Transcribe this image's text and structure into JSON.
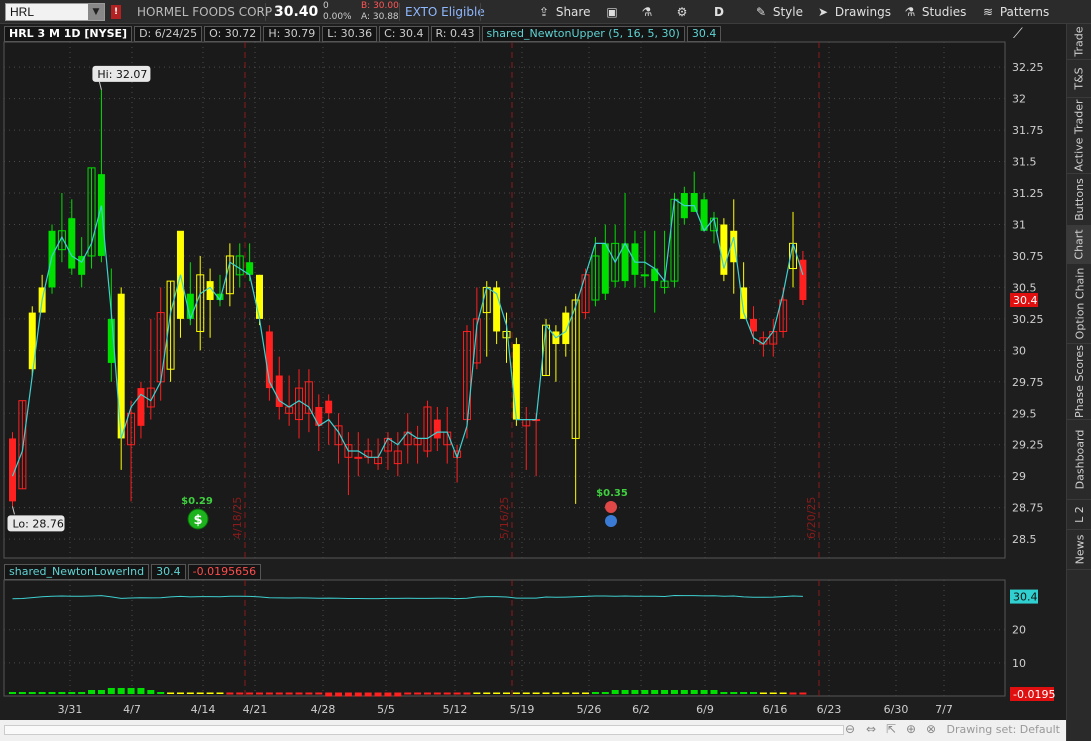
{
  "toolbar": {
    "symbol": "HRL",
    "company": "HORMEL FOODS CORP",
    "last": "30.40",
    "chg_abs": "0",
    "chg_pct": "0.00%",
    "bid": "B: 30.00",
    "ask": "A: 30.88",
    "exto": "EXTO Eligible",
    "share": "Share",
    "aggregation": "D",
    "style": "Style",
    "drawings": "Drawings",
    "studies": "Studies",
    "patterns": "Patterns"
  },
  "header": {
    "symbol": "HRL 3 M 1D [NYSE]",
    "date": "D: 6/24/25",
    "open": "O: 30.72",
    "high": "H: 30.79",
    "low": "L: 30.36",
    "close": "C: 30.4",
    "range": "R: 0.43",
    "study": "shared_NewtonUpper (5, 16, 5, 30)",
    "study_val": "30.4"
  },
  "lower_header": {
    "study": "shared_NewtonLowerInd",
    "value": "30.4",
    "delta": "-0.0195656"
  },
  "annotations": {
    "hi": "Hi: 32.07",
    "lo": "Lo: 28.76",
    "div1": "$0.29",
    "div2": "$0.35",
    "price_tag": "30.4",
    "lower_tag_top": "30.4",
    "lower_tag_bottom": "-0.0195"
  },
  "side_tabs": [
    "Trade",
    "T&S",
    "Active Trader",
    "Buttons",
    "Chart",
    "Option Chain",
    "Phase Scores",
    "Dashboard",
    "L 2",
    "News"
  ],
  "bottom": {
    "drawing_set": "Drawing set: Default"
  },
  "colors": {
    "up": "#00e000",
    "down": "#ff2020",
    "up_weak": "#ffff00",
    "line": "#3fd0d0",
    "grid": "#444444",
    "month_sep": "#8b1a1a"
  },
  "chart_data": {
    "type": "candlestick",
    "price_axis": [
      28.5,
      28.75,
      29,
      29.25,
      29.5,
      29.75,
      30,
      30.25,
      30.5,
      30.75,
      31,
      31.25,
      31.5,
      31.75,
      32,
      32.25
    ],
    "lower_axis": [
      10,
      20
    ],
    "x_ticks": [
      "3/31",
      "4/7",
      "4/14",
      "4/21",
      "4/28",
      "5/5",
      "5/12",
      "5/19",
      "5/26",
      "6/2",
      "6/9",
      "6/16",
      "6/23",
      "6/30",
      "7/7"
    ],
    "month_markers": [
      "4/18/25",
      "5/16/25",
      "6/20/25"
    ],
    "ylim": [
      28.35,
      32.45
    ],
    "candles": [
      {
        "o": 29.3,
        "h": 29.35,
        "l": 28.76,
        "c": 28.8,
        "k": "d"
      },
      {
        "o": 28.9,
        "h": 29.6,
        "l": 28.9,
        "c": 29.6,
        "k": "dh"
      },
      {
        "o": 29.85,
        "h": 30.35,
        "l": 29.8,
        "c": 30.3,
        "k": "y"
      },
      {
        "o": 30.3,
        "h": 30.6,
        "l": 30.3,
        "c": 30.5,
        "k": "y"
      },
      {
        "o": 30.5,
        "h": 31.0,
        "l": 30.45,
        "c": 30.95,
        "k": "g"
      },
      {
        "o": 30.95,
        "h": 31.25,
        "l": 30.7,
        "c": 30.8,
        "k": "gh"
      },
      {
        "o": 30.65,
        "h": 31.2,
        "l": 30.6,
        "c": 31.05,
        "k": "g"
      },
      {
        "o": 30.6,
        "h": 30.9,
        "l": 30.5,
        "c": 30.75,
        "k": "g"
      },
      {
        "o": 30.75,
        "h": 31.45,
        "l": 30.65,
        "c": 31.45,
        "k": "gh"
      },
      {
        "o": 30.75,
        "h": 32.07,
        "l": 30.7,
        "c": 31.4,
        "k": "g"
      },
      {
        "o": 30.25,
        "h": 30.65,
        "l": 29.75,
        "c": 29.9,
        "k": "g"
      },
      {
        "o": 30.45,
        "h": 30.5,
        "l": 29.05,
        "c": 29.3,
        "k": "y"
      },
      {
        "o": 29.25,
        "h": 29.6,
        "l": 28.8,
        "c": 29.5,
        "k": "dh"
      },
      {
        "o": 29.4,
        "h": 29.75,
        "l": 29.3,
        "c": 29.7,
        "k": "d"
      },
      {
        "o": 29.55,
        "h": 30.25,
        "l": 29.45,
        "c": 29.7,
        "k": "dh"
      },
      {
        "o": 29.75,
        "h": 30.5,
        "l": 29.6,
        "c": 30.3,
        "k": "dh"
      },
      {
        "o": 29.85,
        "h": 30.55,
        "l": 29.75,
        "c": 30.55,
        "k": "yh"
      },
      {
        "o": 30.25,
        "h": 30.85,
        "l": 30.1,
        "c": 30.95,
        "k": "y"
      },
      {
        "o": 30.45,
        "h": 30.7,
        "l": 30.2,
        "c": 30.25,
        "k": "g"
      },
      {
        "o": 30.15,
        "h": 30.75,
        "l": 30.0,
        "c": 30.6,
        "k": "yh"
      },
      {
        "o": 30.55,
        "h": 30.65,
        "l": 30.1,
        "c": 30.4,
        "k": "y"
      },
      {
        "o": 30.4,
        "h": 30.6,
        "l": 30.35,
        "c": 30.45,
        "k": "g"
      },
      {
        "o": 30.45,
        "h": 30.85,
        "l": 30.35,
        "c": 30.75,
        "k": "yh"
      },
      {
        "o": 30.6,
        "h": 30.85,
        "l": 30.5,
        "c": 30.75,
        "k": "gh"
      },
      {
        "o": 30.6,
        "h": 30.85,
        "l": 30.55,
        "c": 30.7,
        "k": "g"
      },
      {
        "o": 30.25,
        "h": 30.6,
        "l": 30.2,
        "c": 30.6,
        "k": "y"
      },
      {
        "o": 30.15,
        "h": 30.2,
        "l": 29.6,
        "c": 29.7,
        "k": "d"
      },
      {
        "o": 29.8,
        "h": 29.95,
        "l": 29.45,
        "c": 29.55,
        "k": "d"
      },
      {
        "o": 29.5,
        "h": 29.8,
        "l": 29.4,
        "c": 29.55,
        "k": "dh"
      },
      {
        "o": 29.45,
        "h": 29.85,
        "l": 29.3,
        "c": 29.7,
        "k": "dh"
      },
      {
        "o": 29.75,
        "h": 29.85,
        "l": 29.35,
        "c": 29.5,
        "k": "dh"
      },
      {
        "o": 29.55,
        "h": 29.65,
        "l": 29.2,
        "c": 29.4,
        "k": "d"
      },
      {
        "o": 29.6,
        "h": 29.65,
        "l": 29.25,
        "c": 29.5,
        "k": "d"
      },
      {
        "o": 29.4,
        "h": 29.5,
        "l": 29.1,
        "c": 29.25,
        "k": "dh"
      },
      {
        "o": 29.25,
        "h": 29.35,
        "l": 28.85,
        "c": 29.15,
        "k": "dh"
      },
      {
        "o": 29.15,
        "h": 29.35,
        "l": 29.0,
        "c": 29.15,
        "k": "dh"
      },
      {
        "o": 29.2,
        "h": 29.3,
        "l": 29.1,
        "c": 29.15,
        "k": "dh"
      },
      {
        "o": 29.1,
        "h": 29.3,
        "l": 29.05,
        "c": 29.15,
        "k": "dh"
      },
      {
        "o": 29.3,
        "h": 29.35,
        "l": 29.05,
        "c": 29.2,
        "k": "dh"
      },
      {
        "o": 29.1,
        "h": 29.35,
        "l": 29.0,
        "c": 29.2,
        "k": "dh"
      },
      {
        "o": 29.35,
        "h": 29.5,
        "l": 29.1,
        "c": 29.25,
        "k": "dh"
      },
      {
        "o": 29.25,
        "h": 29.4,
        "l": 29.1,
        "c": 29.3,
        "k": "dh"
      },
      {
        "o": 29.55,
        "h": 29.6,
        "l": 29.15,
        "c": 29.2,
        "k": "dh"
      },
      {
        "o": 29.45,
        "h": 29.55,
        "l": 29.2,
        "c": 29.3,
        "k": "d"
      },
      {
        "o": 29.25,
        "h": 29.55,
        "l": 29.1,
        "c": 29.35,
        "k": "dh"
      },
      {
        "o": 29.15,
        "h": 29.25,
        "l": 28.95,
        "c": 29.2,
        "k": "dh"
      },
      {
        "o": 29.45,
        "h": 30.2,
        "l": 29.3,
        "c": 30.15,
        "k": "dh"
      },
      {
        "o": 29.9,
        "h": 30.5,
        "l": 29.85,
        "c": 30.25,
        "k": "dh"
      },
      {
        "o": 30.3,
        "h": 30.55,
        "l": 29.95,
        "c": 30.5,
        "k": "yh"
      },
      {
        "o": 30.5,
        "h": 30.55,
        "l": 30.05,
        "c": 30.15,
        "k": "y"
      },
      {
        "o": 30.1,
        "h": 30.3,
        "l": 29.9,
        "c": 30.15,
        "k": "yh"
      },
      {
        "o": 30.05,
        "h": 30.1,
        "l": 29.4,
        "c": 29.45,
        "k": "y"
      },
      {
        "o": 29.45,
        "h": 29.55,
        "l": 29.05,
        "c": 29.4,
        "k": "dh"
      },
      {
        "o": 29.45,
        "h": 29.5,
        "l": 29.0,
        "c": 29.45,
        "k": "dh"
      },
      {
        "o": 29.8,
        "h": 30.25,
        "l": 29.8,
        "c": 30.2,
        "k": "yh"
      },
      {
        "o": 30.05,
        "h": 30.2,
        "l": 29.75,
        "c": 30.15,
        "k": "y"
      },
      {
        "o": 30.05,
        "h": 30.35,
        "l": 29.95,
        "c": 30.3,
        "k": "y"
      },
      {
        "o": 29.3,
        "h": 30.45,
        "l": 28.78,
        "c": 30.4,
        "k": "yh"
      },
      {
        "o": 30.3,
        "h": 30.65,
        "l": 30.25,
        "c": 30.6,
        "k": "dh"
      },
      {
        "o": 30.4,
        "h": 30.9,
        "l": 30.35,
        "c": 30.75,
        "k": "gh"
      },
      {
        "o": 30.45,
        "h": 31.0,
        "l": 30.4,
        "c": 30.85,
        "k": "g"
      },
      {
        "o": 30.85,
        "h": 31.0,
        "l": 30.5,
        "c": 30.55,
        "k": "gh"
      },
      {
        "o": 30.55,
        "h": 31.25,
        "l": 30.5,
        "c": 30.85,
        "k": "g"
      },
      {
        "o": 30.85,
        "h": 30.95,
        "l": 30.5,
        "c": 30.6,
        "k": "g"
      },
      {
        "o": 30.6,
        "h": 30.95,
        "l": 30.5,
        "c": 30.6,
        "k": "gh"
      },
      {
        "o": 30.55,
        "h": 30.95,
        "l": 30.3,
        "c": 30.65,
        "k": "g"
      },
      {
        "o": 30.5,
        "h": 30.95,
        "l": 30.45,
        "c": 30.55,
        "k": "gh"
      },
      {
        "o": 30.55,
        "h": 31.25,
        "l": 30.5,
        "c": 31.2,
        "k": "gh"
      },
      {
        "o": 31.05,
        "h": 31.3,
        "l": 31.0,
        "c": 31.25,
        "k": "g"
      },
      {
        "o": 31.25,
        "h": 31.42,
        "l": 31.1,
        "c": 31.1,
        "k": "g"
      },
      {
        "o": 31.2,
        "h": 31.25,
        "l": 30.95,
        "c": 30.95,
        "k": "g"
      },
      {
        "o": 30.95,
        "h": 31.1,
        "l": 30.85,
        "c": 31.05,
        "k": "gh"
      },
      {
        "o": 31.0,
        "h": 31.05,
        "l": 30.55,
        "c": 30.6,
        "k": "y"
      },
      {
        "o": 30.7,
        "h": 31.2,
        "l": 30.45,
        "c": 30.95,
        "k": "y"
      },
      {
        "o": 30.5,
        "h": 30.7,
        "l": 30.25,
        "c": 30.25,
        "k": "y"
      },
      {
        "o": 30.25,
        "h": 30.35,
        "l": 30.05,
        "c": 30.15,
        "k": "d"
      },
      {
        "o": 30.05,
        "h": 30.15,
        "l": 29.95,
        "c": 30.1,
        "k": "dh"
      },
      {
        "o": 30.15,
        "h": 30.25,
        "l": 29.95,
        "c": 30.05,
        "k": "dh"
      },
      {
        "o": 30.15,
        "h": 30.5,
        "l": 30.1,
        "c": 30.4,
        "k": "dh"
      },
      {
        "o": 30.65,
        "h": 31.1,
        "l": 30.5,
        "c": 30.85,
        "k": "yh"
      },
      {
        "o": 30.72,
        "h": 30.79,
        "l": 30.36,
        "c": 30.4,
        "k": "d"
      }
    ],
    "upper_line": [
      29.0,
      29.2,
      29.8,
      30.4,
      30.75,
      30.9,
      30.75,
      30.7,
      30.85,
      31.15,
      30.3,
      29.3,
      29.55,
      29.65,
      29.6,
      29.75,
      30.3,
      30.6,
      30.25,
      30.45,
      30.5,
      30.4,
      30.7,
      30.65,
      30.6,
      30.25,
      29.75,
      29.6,
      29.55,
      29.6,
      29.55,
      29.4,
      29.45,
      29.35,
      29.2,
      29.2,
      29.15,
      29.15,
      29.3,
      29.25,
      29.35,
      29.3,
      29.3,
      29.35,
      29.35,
      29.15,
      29.4,
      30.2,
      30.5,
      30.45,
      30.2,
      29.45,
      29.45,
      29.45,
      30.2,
      30.1,
      30.15,
      30.35,
      30.6,
      30.85,
      30.85,
      30.7,
      30.85,
      30.7,
      30.7,
      30.65,
      30.55,
      31.2,
      31.15,
      31.15,
      30.95,
      31.05,
      30.65,
      30.9,
      30.3,
      30.1,
      30.05,
      30.15,
      30.45,
      30.85,
      30.6
    ],
    "lower_line_note": "oscillator",
    "lower_bars": [
      1,
      1,
      1,
      1,
      1,
      1,
      1,
      1,
      2,
      2,
      3,
      3,
      3,
      3,
      2,
      1,
      0,
      0,
      0,
      0,
      0,
      0,
      -1,
      -1,
      -1,
      -1,
      -1,
      -1,
      -1,
      -1,
      -1,
      -1,
      -2,
      -2,
      -2,
      -2,
      -2,
      -2,
      -2,
      -2,
      -1,
      -1,
      -1,
      -1,
      -1,
      -1,
      -1,
      0,
      0,
      0,
      0,
      0,
      0,
      0,
      0,
      0,
      0,
      0,
      0,
      1,
      1,
      2,
      2,
      2,
      2,
      2,
      2,
      2,
      2,
      2,
      2,
      2,
      1,
      1,
      1,
      1,
      0,
      0,
      0,
      -1,
      -1
    ]
  }
}
